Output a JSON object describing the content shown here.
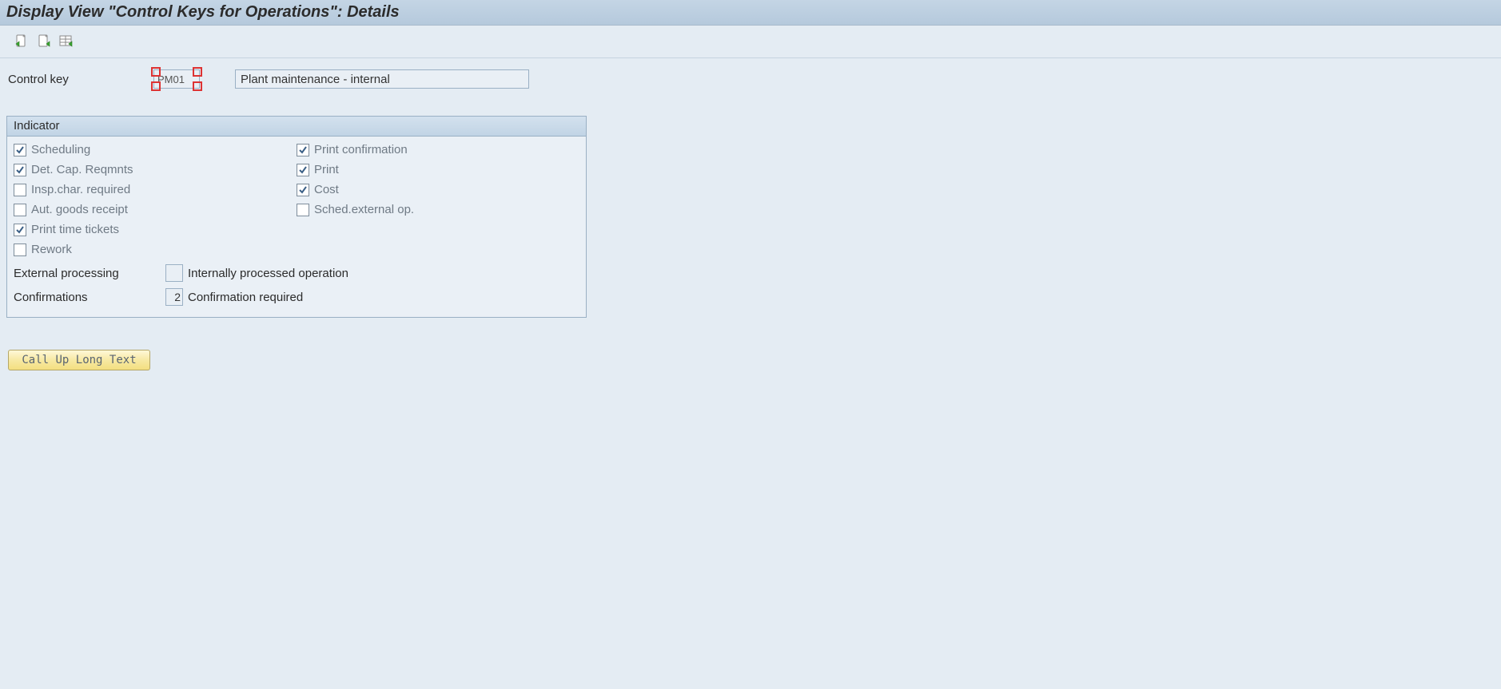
{
  "header": {
    "title": "Display View \"Control Keys for Operations\": Details"
  },
  "toolbar": {
    "icon1": "new-with-green-arrow-icon",
    "icon2": "new-page-green-arrow-icon",
    "icon3": "table-view-icon"
  },
  "control_key": {
    "label": "Control key",
    "value": "PM01",
    "description": "Plant maintenance - internal"
  },
  "indicator": {
    "title": "Indicator",
    "left": [
      {
        "label": "Scheduling",
        "checked": true
      },
      {
        "label": "Det. Cap. Reqmnts",
        "checked": true
      },
      {
        "label": "Insp.char. required",
        "checked": false
      },
      {
        "label": "Aut. goods receipt",
        "checked": false
      },
      {
        "label": "Print time tickets",
        "checked": true
      },
      {
        "label": "Rework",
        "checked": false
      }
    ],
    "right": [
      {
        "label": "Print confirmation",
        "checked": true
      },
      {
        "label": "Print",
        "checked": true
      },
      {
        "label": "Cost",
        "checked": true
      },
      {
        "label": "Sched.external op.",
        "checked": false
      }
    ],
    "external_processing": {
      "label": "External processing",
      "value": "",
      "description": "Internally processed operation"
    },
    "confirmations": {
      "label": "Confirmations",
      "value": "2",
      "description": "Confirmation required"
    }
  },
  "buttons": {
    "long_text": "Call Up Long Text"
  }
}
